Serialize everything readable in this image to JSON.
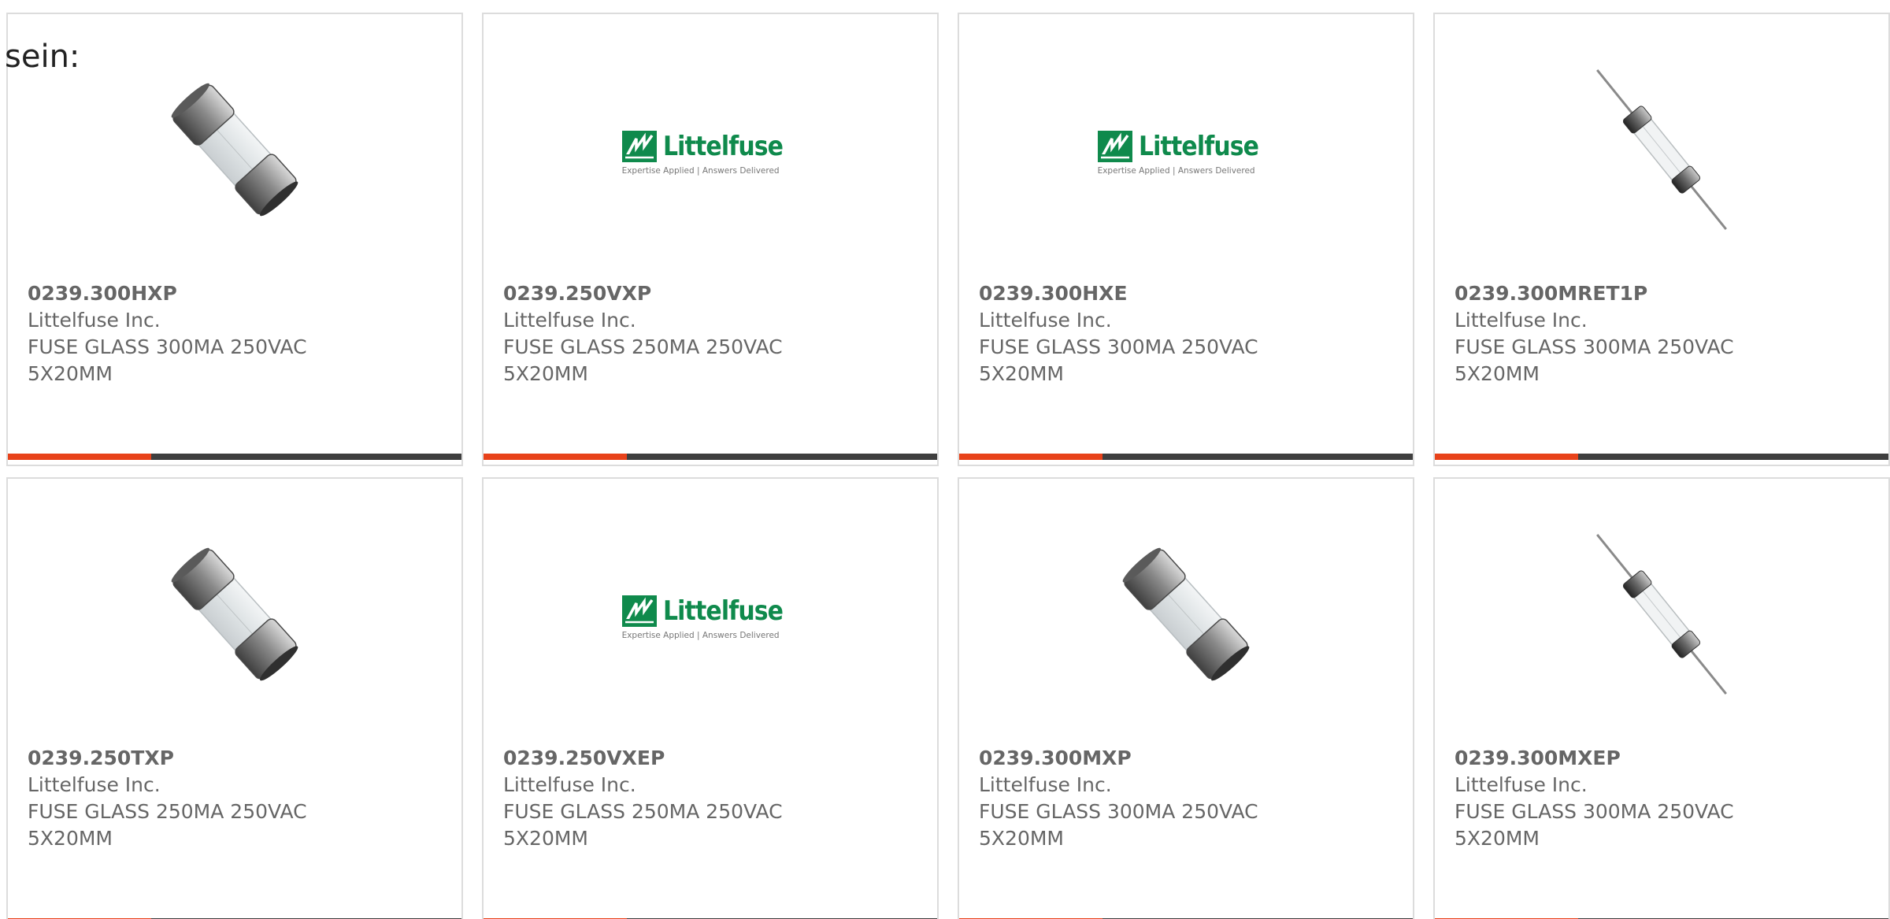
{
  "intro": "sein:",
  "accent_color": "#e8421a",
  "cards": [
    {
      "image": "fuse-glass-image",
      "part_number": "0239.300HXP",
      "manufacturer": "Littelfuse Inc.",
      "description": "FUSE GLASS 300MA 250VAC 5X20MM"
    },
    {
      "image": "littelfuse-logo",
      "logo_name": "Littelfuse",
      "logo_tagline": "Expertise Applied | Answers Delivered",
      "part_number": "0239.250VXP",
      "manufacturer": "Littelfuse Inc.",
      "description": "FUSE GLASS 250MA 250VAC 5X20MM"
    },
    {
      "image": "littelfuse-logo",
      "logo_name": "Littelfuse",
      "logo_tagline": "Expertise Applied | Answers Delivered",
      "part_number": "0239.300HXE",
      "manufacturer": "Littelfuse Inc.",
      "description": "FUSE GLASS 300MA 250VAC 5X20MM"
    },
    {
      "image": "axial-fuse-image",
      "part_number": "0239.300MRET1P",
      "manufacturer": "Littelfuse Inc.",
      "description": "FUSE GLASS 300MA 250VAC 5X20MM"
    },
    {
      "image": "fuse-glass-image",
      "part_number": "0239.250TXP",
      "manufacturer": "Littelfuse Inc.",
      "description": "FUSE GLASS 250MA 250VAC 5X20MM"
    },
    {
      "image": "littelfuse-logo",
      "logo_name": "Littelfuse",
      "logo_tagline": "Expertise Applied | Answers Delivered",
      "part_number": "0239.250VXEP",
      "manufacturer": "Littelfuse Inc.",
      "description": "FUSE GLASS 250MA 250VAC 5X20MM"
    },
    {
      "image": "fuse-glass-image",
      "part_number": "0239.300MXP",
      "manufacturer": "Littelfuse Inc.",
      "description": "FUSE GLASS 300MA 250VAC 5X20MM"
    },
    {
      "image": "axial-fuse-image",
      "part_number": "0239.300MXEP",
      "manufacturer": "Littelfuse Inc.",
      "description": "FUSE GLASS 300MA 250VAC 5X20MM"
    }
  ]
}
